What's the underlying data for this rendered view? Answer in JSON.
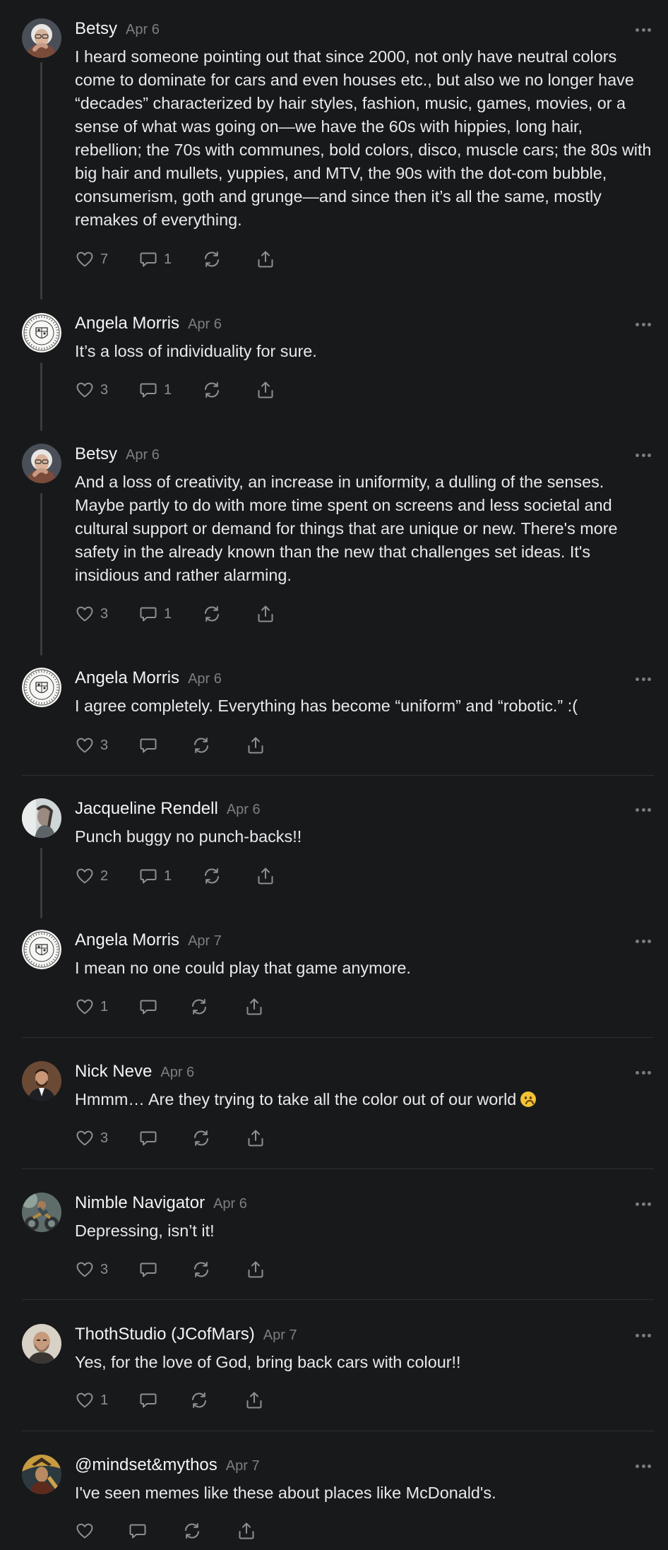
{
  "colors": {
    "background": "#18191b",
    "text_primary": "#f2f2f3",
    "text_muted": "#7d7e82",
    "thread_line": "#3a3b3e",
    "icon": "#8e8f93"
  },
  "comments": [
    {
      "author": "Betsy",
      "date": "Apr 6",
      "avatar": "betsy-avatar",
      "text": "I heard someone pointing out that since 2000, not only have neutral colors come to dominate for cars and even houses etc., but also we no longer have “decades” characterized by hair styles, fashion, music, games, movies, or a sense of what was going on—we have the 60s with hippies, long hair, rebellion; the 70s with communes, bold colors, disco, muscle cars; the 80s with big hair and mullets, yuppies, and MTV, the 90s with the dot-com bubble, consumerism, goth and grunge—and since then it’s all the same, mostly remakes of everything.",
      "likes": "7",
      "replies": "1"
    },
    {
      "author": "Angela Morris",
      "date": "Apr 6",
      "avatar": "seal-avatar",
      "text": "It’s a loss of individuality for sure.",
      "likes": "3",
      "replies": "1"
    },
    {
      "author": "Betsy",
      "date": "Apr 6",
      "avatar": "betsy-avatar",
      "text": "And a loss of creativity, an increase in uniformity, a dulling of the senses. Maybe partly to do with more time spent on screens and less societal and cultural support or demand for things that are unique or new. There's more safety in the already known than the new that challenges set ideas. It's insidious and rather alarming.",
      "likes": "3",
      "replies": "1"
    },
    {
      "author": "Angela Morris",
      "date": "Apr 6",
      "avatar": "seal-avatar",
      "text": "I agree completely. Everything has become “uniform” and “robotic.” :(",
      "likes": "3",
      "replies": ""
    },
    {
      "author": "Jacqueline Rendell",
      "date": "Apr 6",
      "avatar": "jacqueline-avatar",
      "text": "Punch buggy no punch-backs!!",
      "likes": "2",
      "replies": "1"
    },
    {
      "author": "Angela Morris",
      "date": "Apr 7",
      "avatar": "seal-avatar",
      "text": "I mean no one could play that game anymore.",
      "likes": "1",
      "replies": ""
    },
    {
      "author": "Nick Neve",
      "date": "Apr 6",
      "avatar": "nick-avatar",
      "text": "Hmmm… Are they trying to take all the color out of our world",
      "likes": "3",
      "replies": ""
    },
    {
      "author": "Nimble Navigator",
      "date": "Apr 6",
      "avatar": "nimble-avatar",
      "text": "Depressing, isn’t it!",
      "likes": "3",
      "replies": ""
    },
    {
      "author": "ThothStudio (JCofMars)",
      "date": "Apr 7",
      "avatar": "thoth-avatar",
      "text": "Yes, for the love of God, bring back cars with colour!!",
      "likes": "1",
      "replies": ""
    },
    {
      "author": "@mindset&mythos",
      "date": "Apr 7",
      "avatar": "mythos-avatar",
      "text": "I've seen memes like these about places like McDonald's.",
      "likes": "",
      "replies": ""
    }
  ]
}
